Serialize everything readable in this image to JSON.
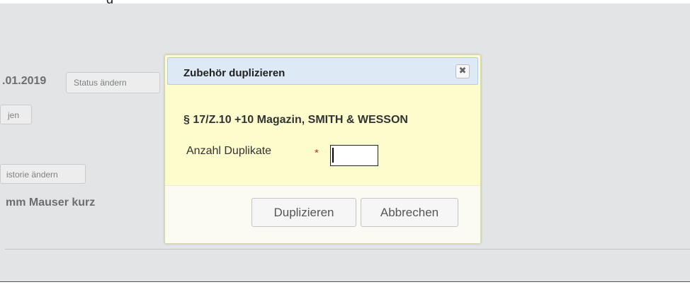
{
  "background": {
    "top_text": "g",
    "date_text": ".01.2019",
    "status_button": "Status ändern",
    "gen_button": "jen",
    "historie_button": "istorie ändern",
    "mauser_text": "mm Mauser kurz"
  },
  "dialog": {
    "title": "Zubehör duplizieren",
    "close_glyph": "✖",
    "item_title": "§ 17/Z.10 +10 Magazin, SMITH & WESSON",
    "field_label": "Anzahl Duplikate",
    "required_marker": "*",
    "field_value": "",
    "buttons": {
      "duplicate": "Duplizieren",
      "cancel": "Abbrechen"
    }
  },
  "colors": {
    "overlay": "#e3e4e5",
    "dialog_body": "#fdfccc",
    "dialog_header": "#dde9f4",
    "required": "#c9302c"
  },
  "icons": {
    "close": "close-icon"
  }
}
